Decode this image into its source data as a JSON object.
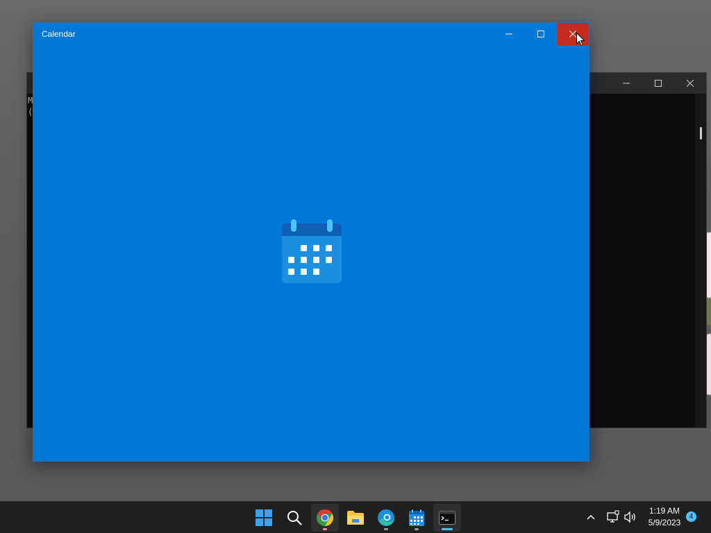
{
  "calendar_window": {
    "title": "Calendar",
    "controls": {
      "minimize": "minimize-icon",
      "maximize": "maximize-icon",
      "close": "close-icon"
    },
    "background_color": "#0078d7",
    "close_hover_color": "#c42b1c"
  },
  "terminal_window": {
    "visible_lines": [
      "M",
      "("
    ]
  },
  "taskbar": {
    "apps": [
      {
        "name": "start",
        "icon": "windows-logo-icon"
      },
      {
        "name": "search",
        "icon": "search-icon"
      },
      {
        "name": "chrome",
        "icon": "chrome-icon",
        "indicator_color": "#ff8fa0"
      },
      {
        "name": "file-explorer",
        "icon": "folder-icon"
      },
      {
        "name": "edge",
        "icon": "edge-icon",
        "indicator_color": "#9a9a9a"
      },
      {
        "name": "calendar",
        "icon": "calendar-icon",
        "indicator_color": "#9a9a9a"
      },
      {
        "name": "terminal",
        "icon": "terminal-icon",
        "indicator_color": "#4cc2ff"
      }
    ],
    "tray": {
      "time": "1:19 AM",
      "date": "5/9/2023",
      "notification_count": "4"
    }
  }
}
